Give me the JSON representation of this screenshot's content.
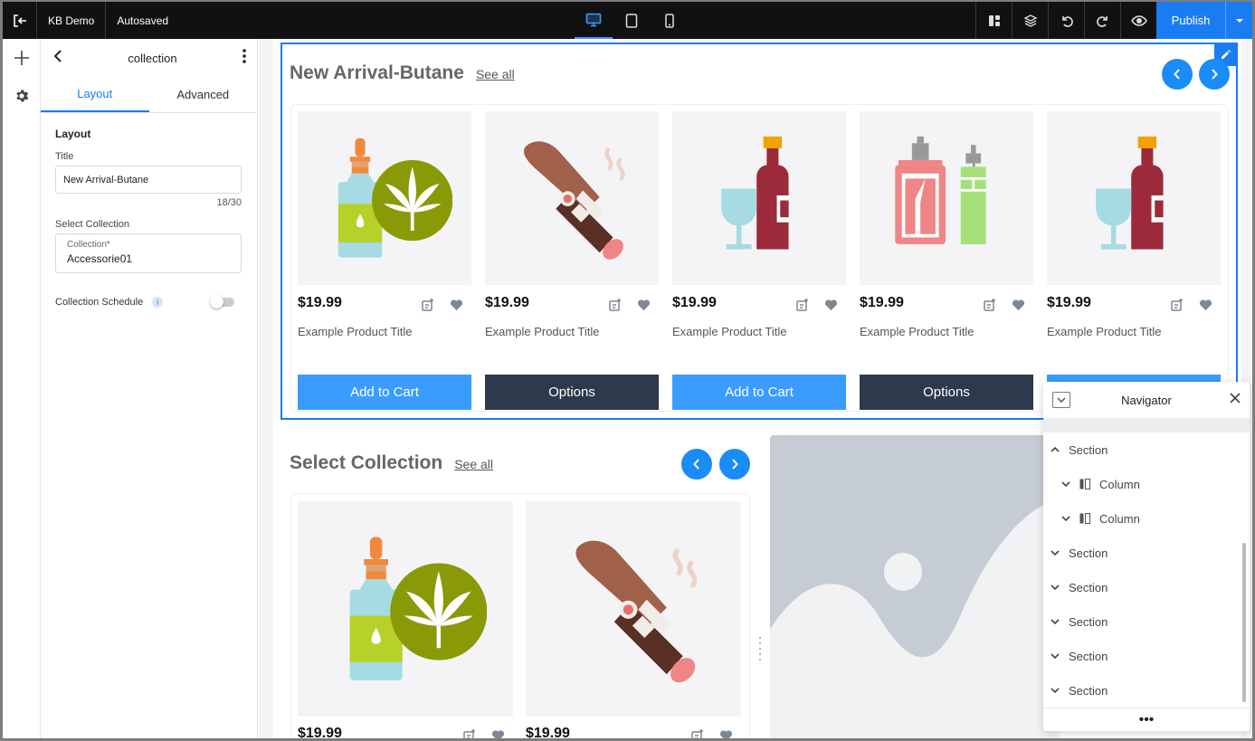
{
  "topbar": {
    "site_name": "KB Demo",
    "save_status": "Autosaved",
    "publish_label": "Publish"
  },
  "panel": {
    "title": "collection",
    "tabs": [
      "Layout",
      "Advanced"
    ],
    "section_title": "Layout",
    "title_label": "Title",
    "title_value": "New Arrival-Butane",
    "title_counter": "18/30",
    "collection_label": "Select Collection",
    "collection_sublabel": "Collection*",
    "collection_value": "Accessorie01",
    "schedule_label": "Collection Schedule"
  },
  "section1": {
    "heading": "New Arrival-Butane",
    "see_all": "See all",
    "products": [
      {
        "image": "cbd-oil-icon",
        "price": "$19.99",
        "title": "Example Product Title",
        "button": "Add to Cart",
        "button_style": "blue"
      },
      {
        "image": "cigar-icon",
        "price": "$19.99",
        "title": "Example Product Title",
        "button": "Options",
        "button_style": "dark"
      },
      {
        "image": "wine-bottle-icon",
        "price": "$19.99",
        "title": "Example Product Title",
        "button": "Add to Cart",
        "button_style": "blue"
      },
      {
        "image": "perfume-vape-icon",
        "price": "$19.99",
        "title": "Example Product Title",
        "button": "Options",
        "button_style": "dark"
      },
      {
        "image": "wine-bottle-icon",
        "price": "$19.99",
        "title": "Example Product Title",
        "button": "",
        "button_style": "blue"
      }
    ]
  },
  "section2": {
    "heading": "Select Collection",
    "see_all": "See all",
    "products": [
      {
        "image": "cbd-oil-icon",
        "price": "$19.99"
      },
      {
        "image": "cigar-icon",
        "price": "$19.99"
      }
    ]
  },
  "navigator": {
    "title": "Navigator",
    "items": [
      {
        "label": "Section",
        "type": "section",
        "expanded": true
      },
      {
        "label": "Column",
        "type": "column",
        "expanded": false
      },
      {
        "label": "Column",
        "type": "column",
        "expanded": false
      },
      {
        "label": "Section",
        "type": "section",
        "expanded": false
      },
      {
        "label": "Section",
        "type": "section",
        "expanded": false
      },
      {
        "label": "Section",
        "type": "section",
        "expanded": false
      },
      {
        "label": "Section",
        "type": "section",
        "expanded": false
      },
      {
        "label": "Section",
        "type": "section",
        "expanded": false
      }
    ],
    "footer": "•••"
  },
  "colors": {
    "accent": "#1a7cf3",
    "button_blue": "#3b9cff",
    "button_dark": "#2d3a4b",
    "topbar": "#111111"
  }
}
